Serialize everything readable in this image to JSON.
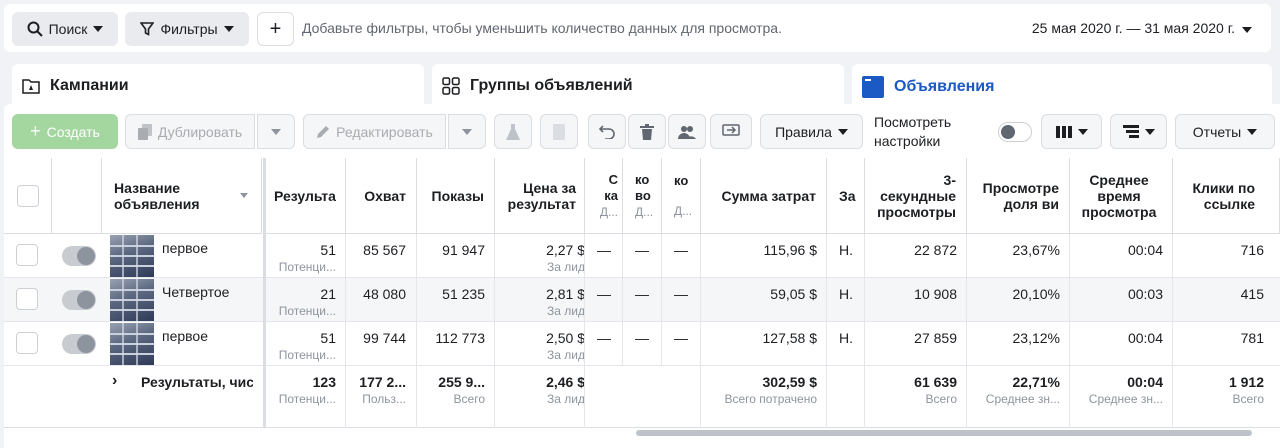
{
  "topbar": {
    "search_label": "Поиск",
    "filters_label": "Фильтры",
    "add_label": "+",
    "hint": "Добавьте фильтры, чтобы уменьшить количество данных для просмотра.",
    "date_range": "25 мая 2020 г. — 31 мая 2020 г."
  },
  "tabs": [
    {
      "label": "Кампании",
      "icon": "folder-icon",
      "active": false
    },
    {
      "label": "Группы объявлений",
      "icon": "grid-icon",
      "active": false
    },
    {
      "label": "Объявления",
      "icon": "ad-icon",
      "active": true
    }
  ],
  "toolbar": {
    "create": "Создать",
    "duplicate": "Дублировать",
    "edit": "Редактировать",
    "rules": "Правила",
    "view_settings": "Посмотреть настройки",
    "reports": "Отчеты"
  },
  "colors": {
    "accent": "#1b59c5",
    "create": "#a4d69f"
  },
  "table": {
    "headers": [
      "Название объявления",
      "Результа",
      "Охват",
      "Показы",
      "Цена за результат",
      "С ка",
      "Д...",
      "ко во",
      "Д...",
      "ко",
      "Д...",
      "Сумма затрат",
      "За",
      "3-секундные просмотры",
      "Просмотре доля ви",
      "Среднее время просмотра",
      "Клики по ссылке"
    ],
    "rows": [
      {
        "name": "первое",
        "results": "51",
        "results_sub": "Потенци...",
        "reach": "85 567",
        "impressions": "91 947",
        "cost": "2,27 $",
        "cost_sub": "За лид",
        "c1": "—",
        "c2": "—",
        "c3": "—",
        "spend": "115,96 $",
        "za": "Н.",
        "v3": "22 872",
        "share": "23,67%",
        "avg": "00:04",
        "clicks": "716"
      },
      {
        "name": "Четвертое",
        "results": "21",
        "results_sub": "Потенци...",
        "reach": "48 080",
        "impressions": "51 235",
        "cost": "2,81 $",
        "cost_sub": "За лид",
        "c1": "—",
        "c2": "—",
        "c3": "—",
        "spend": "59,05 $",
        "za": "Н.",
        "v3": "10 908",
        "share": "20,10%",
        "avg": "00:03",
        "clicks": "415"
      },
      {
        "name": "первое",
        "results": "51",
        "results_sub": "Потенци...",
        "reach": "99 744",
        "impressions": "112 773",
        "cost": "2,50 $",
        "cost_sub": "За лид",
        "c1": "—",
        "c2": "—",
        "c3": "—",
        "spend": "127,58 $",
        "za": "Н.",
        "v3": "27 859",
        "share": "23,12%",
        "avg": "00:04",
        "clicks": "781"
      }
    ],
    "totals": {
      "label": "Результаты, чис",
      "results": "123",
      "results_sub": "Потенци...",
      "reach": "177 2...",
      "reach_sub": "Польз...",
      "impressions": "255 9...",
      "impressions_sub": "Всего",
      "cost": "2,46 $",
      "cost_sub": "За лид",
      "spend": "302,59 $",
      "spend_sub": "Всего потрачено",
      "v3": "61 639",
      "v3_sub": "Всего",
      "share": "22,71%",
      "share_sub": "Среднее зн...",
      "avg": "00:04",
      "avg_sub": "Среднее зн...",
      "clicks": "1 912",
      "clicks_sub": "Всего"
    }
  }
}
